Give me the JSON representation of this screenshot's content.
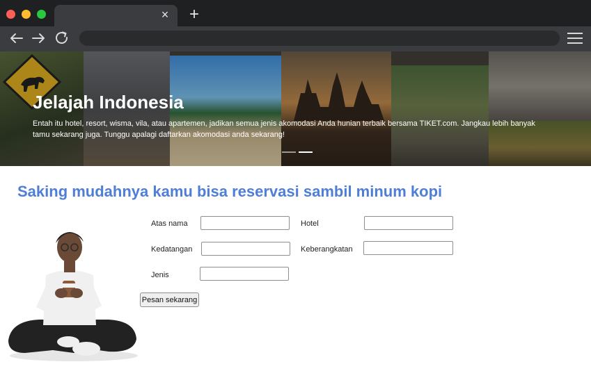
{
  "browser": {
    "tab_close_glyph": "×",
    "new_tab_glyph": "+",
    "url": ""
  },
  "hero": {
    "title": "Jelajah Indonesia",
    "text": "Entah itu hotel, resort, wisma, vila, atau apartemen, jadikan semua jenis akomodasi Anda hunian terbaik bersama TIKET.com. Jangkau lebih banyak tamu sekarang juga. Tunggu apalagi daftarkan akomodasi anda sekarang!"
  },
  "main": {
    "heading": "Saking mudahnya kamu bisa reservasi sambil minum kopi"
  },
  "form": {
    "atas_nama_label": "Atas nama",
    "hotel_label": "Hotel",
    "kedatangan_label": "Kedatangan",
    "keberangkatan_label": "Keberangkatan",
    "jenis_label": "Jenis",
    "submit_label": "Pesan sekarang"
  },
  "colors": {
    "heading": "#4f7ed6",
    "tabbar": "#1f2022",
    "toolbar": "#3a3c3f"
  },
  "icons": [
    "back-arrow-icon",
    "forward-arrow-icon",
    "reload-icon",
    "hamburger-menu-icon",
    "close-icon",
    "plus-icon"
  ]
}
